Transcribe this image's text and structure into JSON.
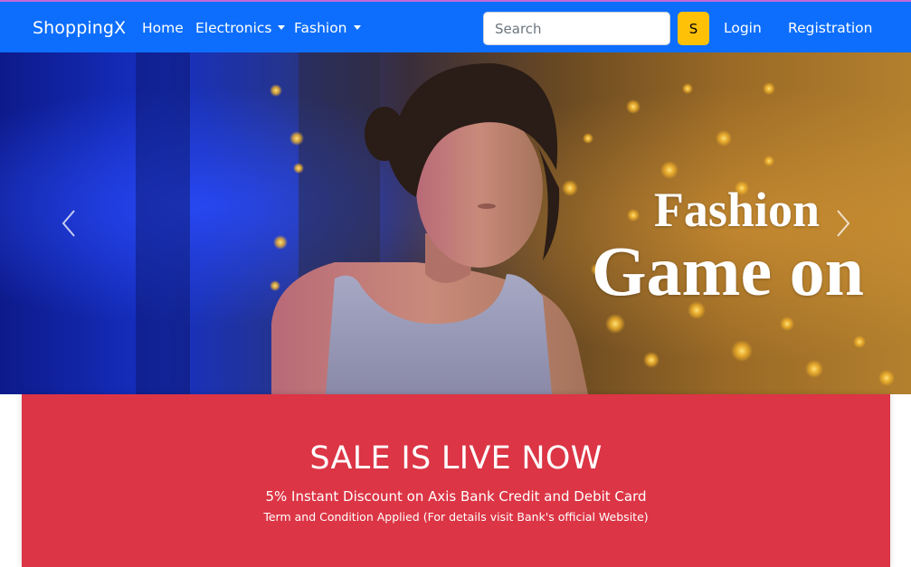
{
  "navbar": {
    "brand": "ShoppingX",
    "links": [
      {
        "label": "Home"
      },
      {
        "label": "Electronics"
      },
      {
        "label": "Fashion"
      }
    ],
    "search": {
      "placeholder": "Search",
      "value": "",
      "button_label": "S"
    },
    "login_label": "Login",
    "registration_label": "Registration"
  },
  "carousel": {
    "caption_line1": "Fashion",
    "caption_line2": "Game on",
    "prev_icon": "chevron-left-icon",
    "next_icon": "chevron-right-icon"
  },
  "sale": {
    "title": "SALE IS LIVE NOW",
    "line1": "5% Instant Discount on Axis Bank Credit and Debit Card",
    "line2": "Term and Condition Applied (For details visit Bank's official Website)"
  },
  "colors": {
    "navbar": "#0d6efd",
    "search_button": "#ffc107",
    "sale_banner": "#dc3545"
  }
}
